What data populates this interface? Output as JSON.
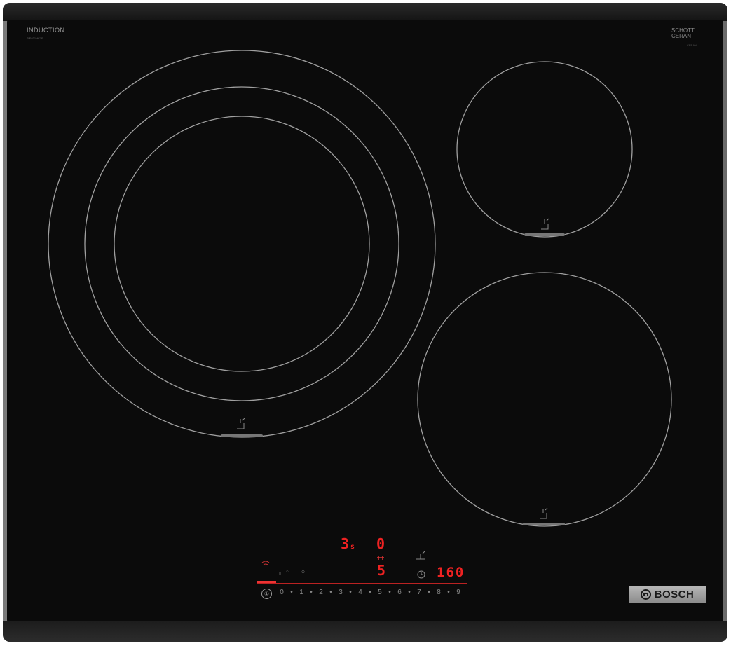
{
  "hob": {
    "type_label": "INDUCTION",
    "model_label": "PIE631HC1E",
    "glass_brand_line1": "SCHOTT",
    "glass_brand_line2": "CERAN",
    "glass_brand_sub": "CERAN",
    "manufacturer": "BOSCH"
  },
  "display": {
    "left_zone_value": "3",
    "left_zone_suffix": "s",
    "right_zone_value": "0",
    "timer_value": "5",
    "temperature_value": "160"
  },
  "power_scale": [
    "0",
    "•",
    "1",
    "•",
    "2",
    "•",
    "3",
    "•",
    "4",
    "•",
    "5",
    "•",
    "6",
    "•",
    "7",
    "•",
    "8",
    "•",
    "9"
  ],
  "power_button_symbol": "①",
  "colors": {
    "glass": "#0b0b0b",
    "zone_outline": "#9a9a9a",
    "display_red": "#e22222",
    "frame": "#9a9a9a"
  }
}
